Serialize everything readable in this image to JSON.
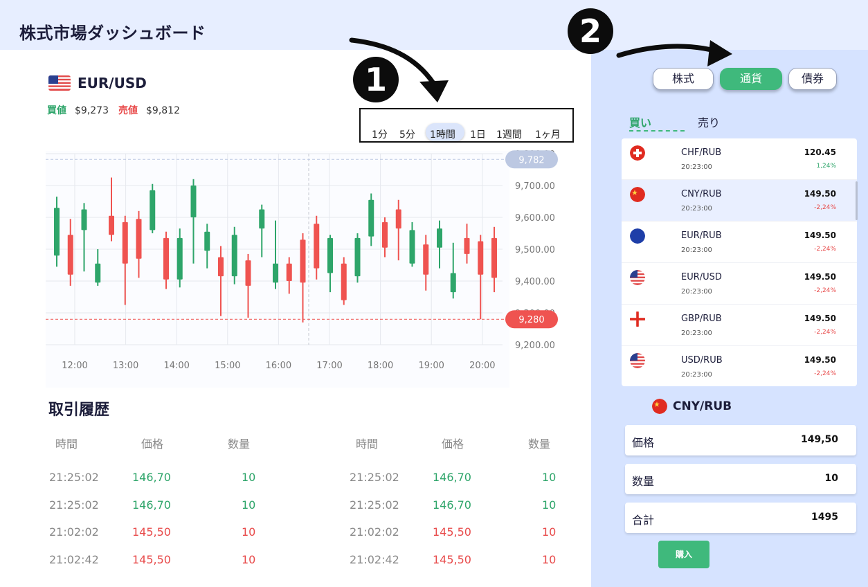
{
  "header": {
    "title": "株式市場ダッシュボード"
  },
  "pair": {
    "name": "EUR/USD",
    "flag_icon": "us-flag-icon",
    "buy_label": "買値",
    "buy_value": "$9,273",
    "sell_label": "売値",
    "sell_value": "$9,812"
  },
  "timeframes": {
    "items": [
      "1分",
      "5分",
      "1時間",
      "1日",
      "1週間",
      "1ヶ月"
    ],
    "selected": "1時間"
  },
  "badges": {
    "one": "1",
    "two": "2"
  },
  "chart_data": {
    "type": "candlestick",
    "x_tick_labels": [
      "12:00",
      "13:00",
      "14:00",
      "15:00",
      "16:00",
      "17:00",
      "18:00",
      "19:00",
      "20:00"
    ],
    "y_tick_labels": [
      "9,800.00",
      "9,700.00",
      "9,600.00",
      "9,500.00",
      "9,400.00",
      "9,300.00",
      "9,200.00"
    ],
    "y_ticks": [
      9800,
      9700,
      9600,
      9500,
      9400,
      9300,
      9200
    ],
    "ylim": [
      9200,
      9800
    ],
    "price_markers": [
      {
        "value": 9782,
        "label": "9,782",
        "color": "#bcc8e2"
      },
      {
        "value": 9280,
        "label": "9,280",
        "color": "#ef5350"
      }
    ],
    "candles": [
      {
        "o": 9480,
        "c": 9630,
        "h": 9665,
        "l": 9445,
        "d": "up"
      },
      {
        "o": 9545,
        "c": 9420,
        "h": 9595,
        "l": 9385,
        "d": "down"
      },
      {
        "o": 9560,
        "c": 9625,
        "h": 9645,
        "l": 9430,
        "d": "up"
      },
      {
        "o": 9395,
        "c": 9455,
        "h": 9500,
        "l": 9385,
        "d": "up"
      },
      {
        "o": 9605,
        "c": 9545,
        "h": 9725,
        "l": 9525,
        "d": "down"
      },
      {
        "o": 9585,
        "c": 9455,
        "h": 9605,
        "l": 9325,
        "d": "down"
      },
      {
        "o": 9595,
        "c": 9470,
        "h": 9620,
        "l": 9410,
        "d": "down"
      },
      {
        "o": 9560,
        "c": 9685,
        "h": 9705,
        "l": 9550,
        "d": "up"
      },
      {
        "o": 9535,
        "c": 9405,
        "h": 9555,
        "l": 9375,
        "d": "down"
      },
      {
        "o": 9405,
        "c": 9535,
        "h": 9565,
        "l": 9380,
        "d": "up"
      },
      {
        "o": 9600,
        "c": 9700,
        "h": 9720,
        "l": 9455,
        "d": "up"
      },
      {
        "o": 9495,
        "c": 9555,
        "h": 9580,
        "l": 9440,
        "d": "up"
      },
      {
        "o": 9475,
        "c": 9415,
        "h": 9510,
        "l": 9290,
        "d": "down"
      },
      {
        "o": 9415,
        "c": 9545,
        "h": 9570,
        "l": 9390,
        "d": "up"
      },
      {
        "o": 9465,
        "c": 9385,
        "h": 9485,
        "l": 9285,
        "d": "down"
      },
      {
        "o": 9565,
        "c": 9625,
        "h": 9640,
        "l": 9475,
        "d": "up"
      },
      {
        "o": 9395,
        "c": 9455,
        "h": 9590,
        "l": 9375,
        "d": "up"
      },
      {
        "o": 9455,
        "c": 9400,
        "h": 9475,
        "l": 9360,
        "d": "down"
      },
      {
        "o": 9530,
        "c": 9395,
        "h": 9550,
        "l": 9270,
        "d": "down"
      },
      {
        "o": 9580,
        "c": 9440,
        "h": 9605,
        "l": 9405,
        "d": "down"
      },
      {
        "o": 9425,
        "c": 9535,
        "h": 9545,
        "l": 9365,
        "d": "up"
      },
      {
        "o": 9455,
        "c": 9340,
        "h": 9475,
        "l": 9325,
        "d": "down"
      },
      {
        "o": 9415,
        "c": 9535,
        "h": 9550,
        "l": 9395,
        "d": "up"
      },
      {
        "o": 9540,
        "c": 9655,
        "h": 9675,
        "l": 9510,
        "d": "up"
      },
      {
        "o": 9585,
        "c": 9505,
        "h": 9600,
        "l": 9475,
        "d": "down"
      },
      {
        "o": 9625,
        "c": 9565,
        "h": 9655,
        "l": 9465,
        "d": "down"
      },
      {
        "o": 9455,
        "c": 9560,
        "h": 9585,
        "l": 9445,
        "d": "up"
      },
      {
        "o": 9515,
        "c": 9420,
        "h": 9545,
        "l": 9370,
        "d": "down"
      },
      {
        "o": 9505,
        "c": 9565,
        "h": 9590,
        "l": 9440,
        "d": "up"
      },
      {
        "o": 9365,
        "c": 9425,
        "h": 9520,
        "l": 9345,
        "d": "up"
      },
      {
        "o": 9535,
        "c": 9485,
        "h": 9580,
        "l": 9455,
        "d": "down"
      },
      {
        "o": 9525,
        "c": 9420,
        "h": 9545,
        "l": 9280,
        "d": "down"
      },
      {
        "o": 9535,
        "c": 9410,
        "h": 9570,
        "l": 9365,
        "d": "down"
      }
    ]
  },
  "trade_history": {
    "title": "取引履歴",
    "columns": [
      "時間",
      "価格",
      "数量"
    ],
    "left_rows": [
      {
        "time": "21:25:02",
        "price": "146,70",
        "qty": "10",
        "side": "buy"
      },
      {
        "time": "21:25:02",
        "price": "146,70",
        "qty": "10",
        "side": "buy"
      },
      {
        "time": "21:02:02",
        "price": "145,50",
        "qty": "10",
        "side": "sell"
      },
      {
        "time": "21:02:42",
        "price": "145,50",
        "qty": "10",
        "side": "sell"
      }
    ],
    "right_rows": [
      {
        "time": "21:25:02",
        "price": "146,70",
        "qty": "10",
        "side": "buy"
      },
      {
        "time": "21:25:02",
        "price": "146,70",
        "qty": "10",
        "side": "buy"
      },
      {
        "time": "21:02:02",
        "price": "145,50",
        "qty": "10",
        "side": "sell"
      },
      {
        "time": "21:02:42",
        "price": "145,50",
        "qty": "10",
        "side": "sell"
      }
    ]
  },
  "market_tabs": {
    "items": [
      "株式",
      "通貨",
      "債券"
    ],
    "selected": "通貨"
  },
  "side_tabs": {
    "buy": "買い",
    "sell": "売り"
  },
  "pairs": [
    {
      "name": "CHF/RUB",
      "time": "20:23:00",
      "price": "120.45",
      "change": "1,24%",
      "dir": "up",
      "flag": "swiss-flag-icon"
    },
    {
      "name": "CNY/RUB",
      "time": "20:23:00",
      "price": "149.50",
      "change": "-2,24%",
      "dir": "down",
      "flag": "china-flag-icon"
    },
    {
      "name": "EUR/RUB",
      "time": "20:23:00",
      "price": "149.50",
      "change": "-2,24%",
      "dir": "down",
      "flag": "eu-flag-icon"
    },
    {
      "name": "EUR/USD",
      "time": "20:23:00",
      "price": "149.50",
      "change": "-2,24%",
      "dir": "down",
      "flag": "us-flag-icon"
    },
    {
      "name": "GBP/RUB",
      "time": "20:23:00",
      "price": "149.50",
      "change": "-2,24%",
      "dir": "down",
      "flag": "england-flag-icon"
    },
    {
      "name": "USD/RUB",
      "time": "20:23:00",
      "price": "149.50",
      "change": "-2,24%",
      "dir": "down",
      "flag": "us-flag-icon"
    }
  ],
  "order": {
    "pair": "CNY/RUB",
    "pair_flag": "china-flag-icon",
    "price_label": "価格",
    "price_value": "149,50",
    "qty_label": "数量",
    "qty_value": "10",
    "total_label": "合計",
    "total_value": "1495",
    "buy_button": "購入"
  },
  "colors": {
    "accent_green": "#3fb97c",
    "up": "#2ea56a",
    "down": "#ef5350",
    "panel_bg": "#d6e3ff",
    "header_bg": "#e7eeff"
  }
}
